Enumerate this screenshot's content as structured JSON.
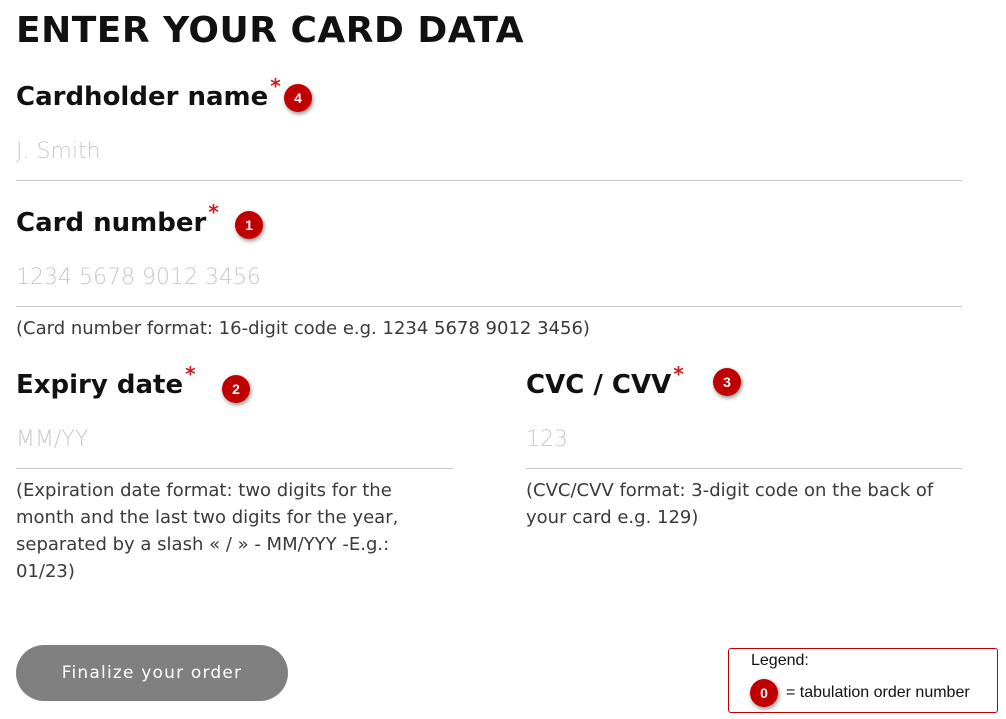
{
  "title": "ENTER YOUR CARD DATA",
  "required_mark": "*",
  "fields": {
    "cardholder": {
      "label": "Cardholder name",
      "placeholder": "J. Smith",
      "value": "",
      "tab_order": "4"
    },
    "card_number": {
      "label": "Card number",
      "placeholder": "1234 5678 9012 3456",
      "value": "",
      "tab_order": "1",
      "hint": "(Card number format: 16-digit code e.g. 1234 5678 9012 3456)"
    },
    "expiry": {
      "label": "Expiry date",
      "placeholder": "MM/YY",
      "value": "",
      "tab_order": "2",
      "hint": "(Expiration date format: two digits for the month and the last two digits for the year, separated by a slash « / » - MM/YYY -E.g.: 01/23)"
    },
    "cvc": {
      "label": "CVC / CVV",
      "placeholder": "123",
      "value": "",
      "tab_order": "3",
      "hint": "(CVC/CVV format: 3-digit code on the back of your card e.g. 129)"
    }
  },
  "submit_label": "Finalize your order",
  "legend": {
    "title": "Legend:",
    "badge": "0",
    "text": "= tabulation order number"
  },
  "colors": {
    "accent": "#c00000",
    "button": "#808080",
    "placeholder": "#c8c8c8",
    "underline": "#c9c9c9"
  }
}
